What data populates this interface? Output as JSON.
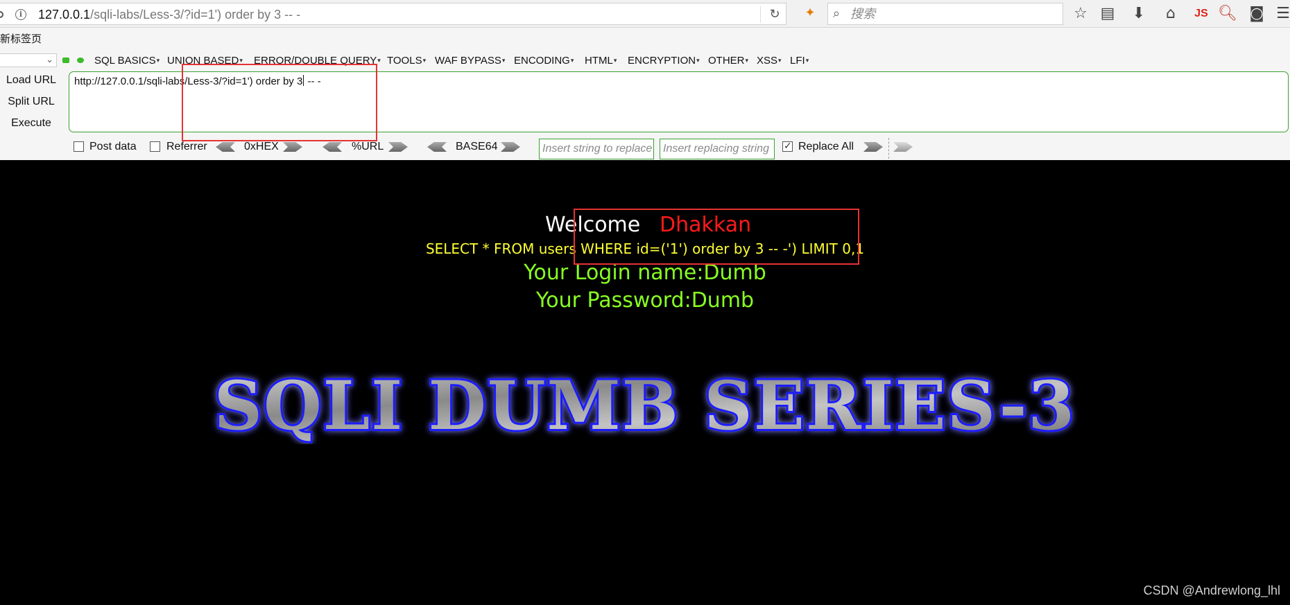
{
  "browser": {
    "url_host": "127.0.0.1",
    "url_path": "/sqli-labs/Less-3/?id=1') order by 3 -- -",
    "search_placeholder": "搜索",
    "bookmark": "新标签页",
    "js_icon_label": "JS"
  },
  "hackbar": {
    "menu": [
      "SQL BASICS",
      "UNION BASED",
      "ERROR/DOUBLE QUERY",
      "TOOLS",
      "WAF BYPASS",
      "ENCODING",
      "HTML",
      "ENCRYPTION",
      "OTHER",
      "XSS",
      "LFI"
    ],
    "load_url": "Load URL",
    "split_url": "Split URL",
    "execute": "Execute",
    "url_before_caret": "http://127.0.0.1/sqli-labs/Less-3/?id=1') order by 3",
    "url_after_caret": " -- -",
    "post_data": "Post data",
    "referrer": "Referrer",
    "hex": "0xHEX",
    "url_enc": "%URL",
    "base64": "BASE64",
    "insert_string_placeholder": "Insert string to replace",
    "insert_replacing_placeholder": "Insert replacing string",
    "replace_all": "Replace All"
  },
  "page": {
    "welcome": "Welcome",
    "name": "Dhakkan",
    "query": "SELECT * FROM users WHERE id=('1') order by 3 -- -') LIMIT 0,1",
    "login": "Your Login name:Dumb",
    "password": "Your Password:Dumb",
    "series_title": "SQLI DUMB SERIES-3"
  },
  "watermark": "CSDN @Andrewlong_lhl",
  "colors": {
    "query": "#ffff33",
    "login": "#88ff22",
    "name": "#ff1a1a",
    "annotation": "#e63232",
    "hackbar_border": "#3aa031"
  }
}
